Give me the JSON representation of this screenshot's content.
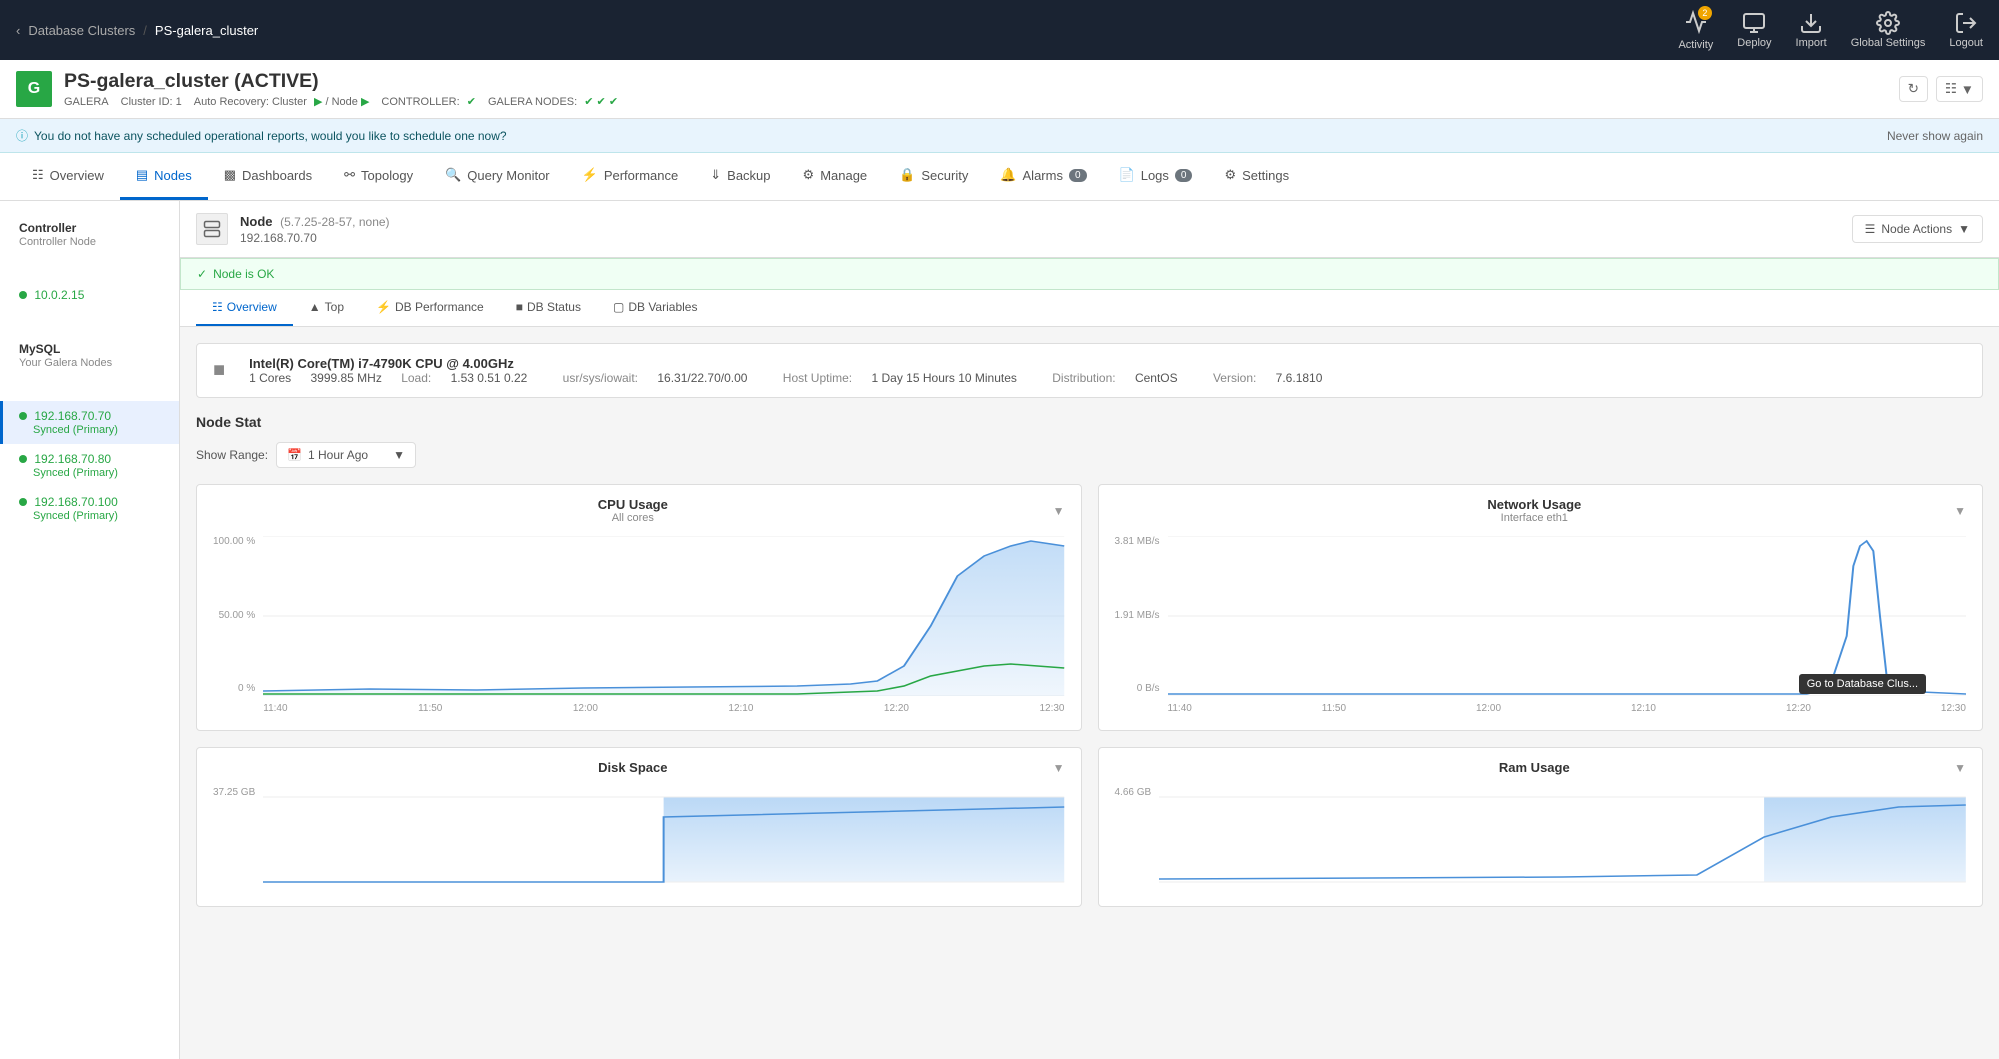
{
  "topNav": {
    "backLink": "Database Clusters",
    "clusterName": "PS-galera_cluster",
    "navItems": [
      {
        "id": "activity",
        "label": "Activity",
        "badge": "2"
      },
      {
        "id": "deploy",
        "label": "Deploy"
      },
      {
        "id": "import",
        "label": "Import"
      },
      {
        "id": "global-settings",
        "label": "Global Settings"
      },
      {
        "id": "logout",
        "label": "Logout"
      }
    ]
  },
  "clusterBanner": {
    "iconText": "G",
    "clusterTitle": "PS-galera_cluster (ACTIVE)",
    "type": "GALERA",
    "clusterId": "Cluster ID: 1",
    "autoRecovery": "Auto Recovery: Cluster",
    "controller": "CONTROLLER:",
    "controllerStatus": "✔",
    "galeraNodes": "GALERA NODES:",
    "galeraNodeStatus": "✔ ✔ ✔"
  },
  "infoBar": {
    "message": "You do not have any scheduled operational reports, would you like to schedule one now?",
    "dismissLabel": "Never show again"
  },
  "mainTabs": [
    {
      "id": "overview",
      "label": "Overview",
      "icon": "grid"
    },
    {
      "id": "nodes",
      "label": "Nodes",
      "icon": "server",
      "active": true
    },
    {
      "id": "dashboards",
      "label": "Dashboards",
      "icon": "chart"
    },
    {
      "id": "topology",
      "label": "Topology",
      "icon": "topology"
    },
    {
      "id": "query-monitor",
      "label": "Query Monitor",
      "icon": "search"
    },
    {
      "id": "performance",
      "label": "Performance",
      "icon": "gauge"
    },
    {
      "id": "backup",
      "label": "Backup",
      "icon": "download"
    },
    {
      "id": "manage",
      "label": "Manage",
      "icon": "settings"
    },
    {
      "id": "security",
      "label": "Security",
      "icon": "shield"
    },
    {
      "id": "alarms",
      "label": "Alarms",
      "badge": "0"
    },
    {
      "id": "logs",
      "label": "Logs",
      "badge": "0"
    },
    {
      "id": "settings",
      "label": "Settings",
      "icon": "gear"
    }
  ],
  "sidebar": {
    "groups": [
      {
        "id": "controller",
        "items": [
          {
            "id": "controller-node",
            "title": "Controller",
            "sub": "Controller Node"
          }
        ]
      },
      {
        "id": "ip",
        "items": [
          {
            "id": "ip1",
            "title": "10.0.2.15",
            "isIp": true
          }
        ]
      },
      {
        "id": "mysql-group",
        "items": [
          {
            "id": "mysql",
            "title": "MySQL",
            "sub": "Your Galera Nodes"
          }
        ]
      },
      {
        "id": "nodes",
        "items": [
          {
            "id": "node-192-168-70-70",
            "title": "192.168.70.70",
            "sub": "Synced (Primary)",
            "active": true
          },
          {
            "id": "node-192-168-70-80",
            "title": "192.168.70.80",
            "sub": "Synced (Primary)"
          },
          {
            "id": "node-192-168-70-100",
            "title": "192.168.70.100",
            "sub": "Synced (Primary)"
          }
        ]
      }
    ]
  },
  "nodeHeader": {
    "title": "Node",
    "version": "(5.7.25-28-57, none)",
    "ip": "192.168.70.70",
    "actionsLabel": "Node Actions"
  },
  "nodeStatus": {
    "message": "Node is OK"
  },
  "nodeTabs": [
    {
      "id": "overview",
      "label": "Overview",
      "active": true
    },
    {
      "id": "top",
      "label": "Top"
    },
    {
      "id": "db-performance",
      "label": "DB Performance"
    },
    {
      "id": "db-status",
      "label": "DB Status"
    },
    {
      "id": "db-variables",
      "label": "DB Variables"
    }
  ],
  "cpuInfo": {
    "name": "Intel(R) Core(TM) i7-4790K CPU @ 4.00GHz",
    "cores": "1 Cores",
    "mhz": "3999.85 MHz",
    "load": "Load:",
    "loadValue": "1.53 0.51 0.22",
    "usr": "usr/sys/iowait:",
    "usrValue": "16.31/22.70/0.00",
    "hostUptime": "Host Uptime:",
    "hostUptimeValue": "1 Day 15 Hours 10 Minutes",
    "distribution": "Distribution:",
    "distributionValue": "CentOS",
    "version": "Version:",
    "versionValue": "7.6.1810"
  },
  "nodeStat": {
    "title": "Node Stat",
    "showRangeLabel": "Show Range:",
    "rangeValue": "1 Hour Ago"
  },
  "charts": [
    {
      "id": "cpu-usage",
      "title": "CPU Usage",
      "subtitle": "All cores",
      "yLabels": [
        "100.00 %",
        "50.00 %",
        "0 %"
      ],
      "xLabels": [
        "11:40",
        "11:50",
        "12:00",
        "12:10",
        "12:20",
        "12:30"
      ],
      "type": "area"
    },
    {
      "id": "network-usage",
      "title": "Network Usage",
      "subtitle": "Interface eth1",
      "yLabels": [
        "3.81 MB/s",
        "1.91 MB/s",
        "0 B/s"
      ],
      "xLabels": [
        "11:40",
        "11:50",
        "12:00",
        "12:10",
        "12:20",
        "12:30"
      ],
      "type": "line"
    },
    {
      "id": "disk-space",
      "title": "Disk Space",
      "subtitle": "",
      "yLabels": [
        "37.25 GB",
        "",
        ""
      ],
      "xLabels": [],
      "type": "area"
    },
    {
      "id": "ram-usage",
      "title": "Ram Usage",
      "subtitle": "",
      "yLabels": [
        "4.66 GB",
        "",
        ""
      ],
      "xLabels": [],
      "type": "area"
    }
  ],
  "tooltip": {
    "text": "Go to Database Clus..."
  }
}
